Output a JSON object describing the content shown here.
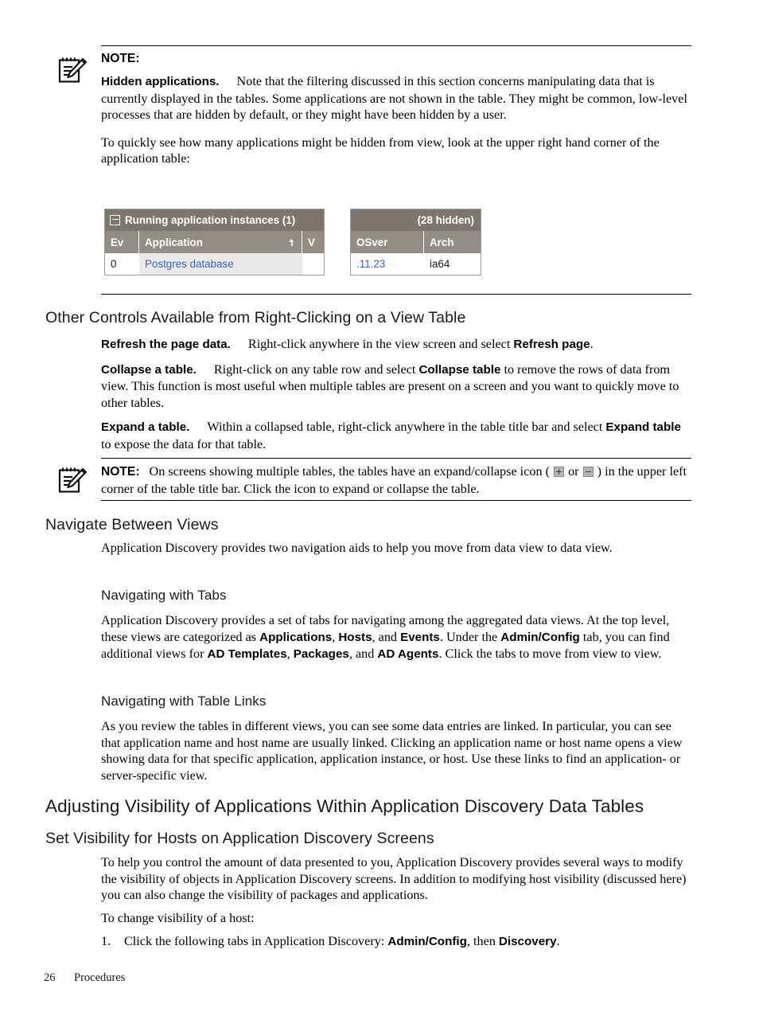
{
  "note1": {
    "icon": "note-pencil-icon",
    "label": "NOTE:",
    "runin": "Hidden applications.",
    "para1": "Note that the filtering discussed in this section concerns manipulating data that is currently displayed in the tables. Some applications are not shown in the table. They might be common, low-level processes that are hidden by default, or they might have been hidden by a user.",
    "para2": "To quickly see how many applications might be hidden from view, look at the upper right hand corner of the application table:"
  },
  "screenshot_table": {
    "left": {
      "title": "Running application instances (1)",
      "collapse_icon": "collapse-minus-icon",
      "headers": [
        "Ev",
        "Application",
        "V"
      ],
      "sort_indicator": "sort-ascending-arrow-icon",
      "row": [
        "0",
        "Postgres database",
        ""
      ]
    },
    "right": {
      "title": "(28 hidden)",
      "headers": [
        "OSver",
        "Arch"
      ],
      "row": [
        ".11.23",
        "ia64"
      ]
    },
    "colors": {
      "title_bar": "#7c766e",
      "header_bar": "#938d85",
      "link_text": "#3a5fc4",
      "row_shade": "#eceae8"
    }
  },
  "section_other_controls": {
    "heading": "Other Controls Available from Right-Clicking on a View Table",
    "items": [
      {
        "runin": "Refresh the page data.",
        "text_before": "Right-click anywhere in the view screen and select ",
        "bold_inline": "Refresh page",
        "text_after": "."
      },
      {
        "runin": "Collapse a table.",
        "text_before": "Right-click on any table row and select ",
        "bold_inline": "Collapse table",
        "text_after": " to remove the rows of data from view. This function is most useful when multiple tables are present on a screen and you want to quickly move to other tables."
      },
      {
        "runin": "Expand a table.",
        "text_before": "Within a collapsed table, right-click anywhere in the table title bar and select ",
        "bold_inline": "Expand table",
        "text_after": " to expose the data for that table."
      }
    ]
  },
  "note2": {
    "icon": "note-pencil-icon",
    "label": "NOTE:",
    "text_a": "On screens showing multiple tables, the tables have an expand/collapse icon ( ",
    "icon_expand": "expand-plus-icon",
    "text_or": " or ",
    "icon_collapse": "collapse-minus-icon",
    "text_b": " ) in the upper left corner of the table title bar. Click the icon to expand or collapse the table."
  },
  "section_navigate": {
    "heading": "Navigate Between Views",
    "intro": "Application Discovery provides two navigation aids to help you move from data view to data view.",
    "sub_tabs": {
      "heading": "Navigating with Tabs",
      "t1": "Application Discovery provides a set of tabs for navigating among the aggregated data views. At the top level, these views are categorized as ",
      "b1": "Applications",
      "t2": ", ",
      "b2": "Hosts",
      "t3": ", and ",
      "b3": "Events",
      "t4": ". Under the ",
      "b4": "Admin/Config",
      "t5": " tab, you can find additional views for ",
      "b5": "AD Templates",
      "t6": ", ",
      "b6": "Packages",
      "t7": ", and ",
      "b7": "AD Agents",
      "t8": ". Click the tabs to move from view to view."
    },
    "sub_links": {
      "heading": "Navigating with Table Links",
      "text": "As you review the tables in different views, you can see some data entries are linked. In particular, you can see that application name and host name are usually linked. Clicking an application name or host name opens a view showing data for that specific application, application instance, or host. Use these links to find an application- or server-specific view."
    }
  },
  "section_adjusting": {
    "heading": "Adjusting Visibility of Applications Within Application Discovery Data Tables",
    "sub_heading": "Set Visibility for Hosts on Application Discovery Screens",
    "para1": "To help you control the amount of data presented to you, Application Discovery provides several ways to modify the visibility of objects in Application Discovery screens. In addition to modifying host visibility (discussed here) you can also change the visibility of packages and applications.",
    "para2": "To change visibility of a host:",
    "list": [
      {
        "number": "1.",
        "text_before": "Click the following tabs in Application Discovery: ",
        "b1": "Admin/Config",
        "text_mid": ", then ",
        "b2": "Discovery",
        "text_after": "."
      }
    ]
  },
  "footer": {
    "page_number": "26",
    "section_name": "Procedures"
  }
}
